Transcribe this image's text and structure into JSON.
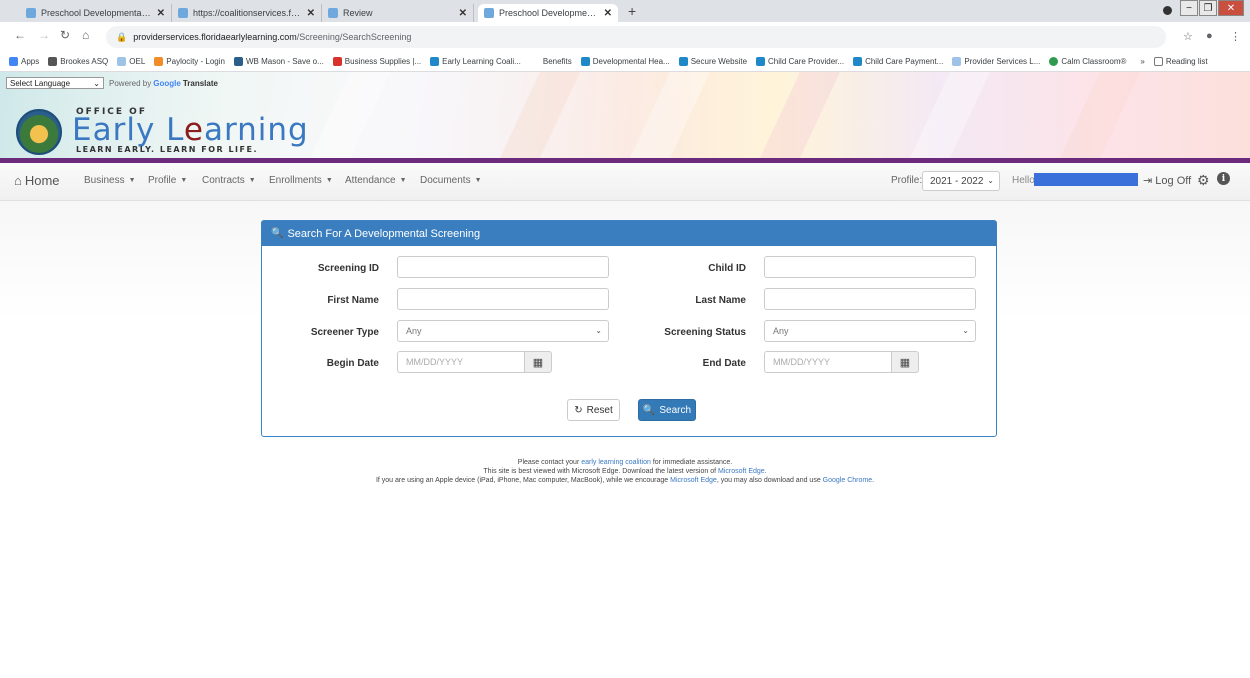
{
  "browser": {
    "tabs": [
      {
        "label": "Preschool Developmental Screen",
        "active": false
      },
      {
        "label": "https://coalitionservices.floridaea",
        "active": false
      },
      {
        "label": "Review",
        "active": false
      },
      {
        "label": "Preschool Developmental Screen",
        "active": true
      }
    ],
    "tab_close": "✕",
    "new_tab": "+",
    "url_host": "providerservices.floridaearlylearning.com",
    "url_path": "/Screening/SearchScreening",
    "bookmarks": [
      {
        "label": "Apps",
        "color": "#4285f4"
      },
      {
        "label": "Brookes ASQ",
        "color": "#555555"
      },
      {
        "label": "OEL",
        "color": "#9ec3e6"
      },
      {
        "label": "Paylocity - Login",
        "color": "#f28c28"
      },
      {
        "label": "WB Mason - Save o...",
        "color": "#2b5e8a"
      },
      {
        "label": "Business Supplies |...",
        "color": "#d9312b"
      },
      {
        "label": "Early Learning Coali...",
        "color": "#1e88c9"
      },
      {
        "label": "Benefits",
        "color": "#ffffff"
      },
      {
        "label": "Developmental Hea...",
        "color": "#1e88c9"
      },
      {
        "label": "Secure Website",
        "color": "#1e88c9"
      },
      {
        "label": "Child Care Provider...",
        "color": "#1e88c9"
      },
      {
        "label": "Child Care Payment...",
        "color": "#1e88c9"
      },
      {
        "label": "Provider Services L...",
        "color": "#9ec3e6"
      },
      {
        "label": "Calm Classroom®",
        "color": "#2e9b4f"
      },
      {
        "label": "»",
        "color": "#ffffff"
      },
      {
        "label": "Reading list",
        "color": "#777777"
      }
    ]
  },
  "language": {
    "select_label": "Select Language",
    "powered_by": "Powered by",
    "google": "Google",
    "translate": "Translate"
  },
  "logo": {
    "office_of": "OFFICE OF",
    "main_blue1": "Early L",
    "main_red": "e",
    "main_blue2": "arning",
    "tagline": "LEARN EARLY. LEARN FOR LIFE."
  },
  "nav": {
    "home": "Home",
    "items": [
      "Business",
      "Profile",
      "Contracts",
      "Enrollments",
      "Attendance",
      "Documents"
    ],
    "profile_label": "Profile:",
    "profile_value": "2021 - 2022",
    "hello": "Hello",
    "logoff": "Log Off"
  },
  "search": {
    "title": "Search For A Developmental Screening",
    "screening_id_label": "Screening ID",
    "child_id_label": "Child ID",
    "first_name_label": "First Name",
    "last_name_label": "Last Name",
    "screener_type_label": "Screener Type",
    "screener_type_value": "Any",
    "screening_status_label": "Screening Status",
    "screening_status_value": "Any",
    "begin_date_label": "Begin Date",
    "begin_date_placeholder": "MM/DD/YYYY",
    "end_date_label": "End Date",
    "end_date_placeholder": "MM/DD/YYYY",
    "reset_label": "Reset",
    "search_label": "Search"
  },
  "footer": {
    "line1_a": "Please contact your ",
    "line1_link": "early learning coalition",
    "line1_b": " for immediate assistance.",
    "line2_a": "This site is best viewed with Microsoft Edge. Download the latest version of ",
    "line2_link": "Microsoft Edge",
    "line2_b": ".",
    "line3_a": "If you are using an Apple device (iPad, iPhone, Mac computer, MacBook), while we encourage ",
    "line3_link1": "Microsoft Edge",
    "line3_b": ", you may also download and use ",
    "line3_link2": "Google Chrome",
    "line3_c": "."
  },
  "colors": {
    "panel_header": "#3a7ebf",
    "search_button": "#337ab7",
    "brand_purple": "#6b2a7c",
    "logo_blue": "#3a78c2"
  }
}
